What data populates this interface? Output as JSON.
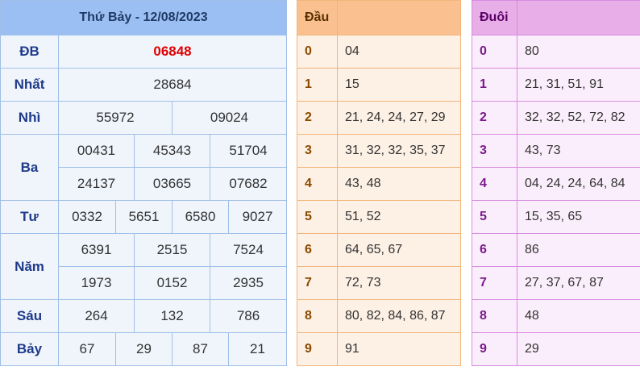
{
  "results": {
    "title": "Thứ Bảy - 12/08/2023",
    "labels": {
      "db": "ĐB",
      "nhat": "Nhất",
      "nhi": "Nhì",
      "ba": "Ba",
      "tu": "Tư",
      "nam": "Năm",
      "sau": "Sáu",
      "bay": "Bảy"
    },
    "db": "06848",
    "nhat": "28684",
    "nhi": [
      "55972",
      "09024"
    ],
    "ba": [
      "00431",
      "45343",
      "51704",
      "24137",
      "03665",
      "07682"
    ],
    "tu": [
      "0332",
      "5651",
      "6580",
      "9027"
    ],
    "nam": [
      "6391",
      "2515",
      "7524",
      "1973",
      "0152",
      "2935"
    ],
    "sau": [
      "264",
      "132",
      "786"
    ],
    "bay": [
      "67",
      "29",
      "87",
      "21"
    ]
  },
  "head": {
    "title": "Đầu",
    "rows": [
      {
        "k": "0",
        "v": "04"
      },
      {
        "k": "1",
        "v": "15"
      },
      {
        "k": "2",
        "v": "21, 24, 24, 27, 29"
      },
      {
        "k": "3",
        "v": "31, 32, 32, 35, 37"
      },
      {
        "k": "4",
        "v": "43, 48"
      },
      {
        "k": "5",
        "v": "51, 52"
      },
      {
        "k": "6",
        "v": "64, 65, 67"
      },
      {
        "k": "7",
        "v": "72, 73"
      },
      {
        "k": "8",
        "v": "80, 82, 84, 86, 87"
      },
      {
        "k": "9",
        "v": "91"
      }
    ]
  },
  "tail": {
    "title": "Đuôi",
    "rows": [
      {
        "k": "0",
        "v": "80"
      },
      {
        "k": "1",
        "v": "21, 31, 51, 91"
      },
      {
        "k": "2",
        "v": "32, 32, 52, 72, 82"
      },
      {
        "k": "3",
        "v": "43, 73"
      },
      {
        "k": "4",
        "v": "04, 24, 24, 64, 84"
      },
      {
        "k": "5",
        "v": "15, 35, 65"
      },
      {
        "k": "6",
        "v": "86"
      },
      {
        "k": "7",
        "v": "27, 37, 67, 87"
      },
      {
        "k": "8",
        "v": "48"
      },
      {
        "k": "9",
        "v": "29"
      }
    ]
  },
  "colors": {
    "special": "#e00000",
    "results_header": "#9bbff2",
    "head_header": "#fac08f",
    "tail_header": "#e7aee8"
  }
}
